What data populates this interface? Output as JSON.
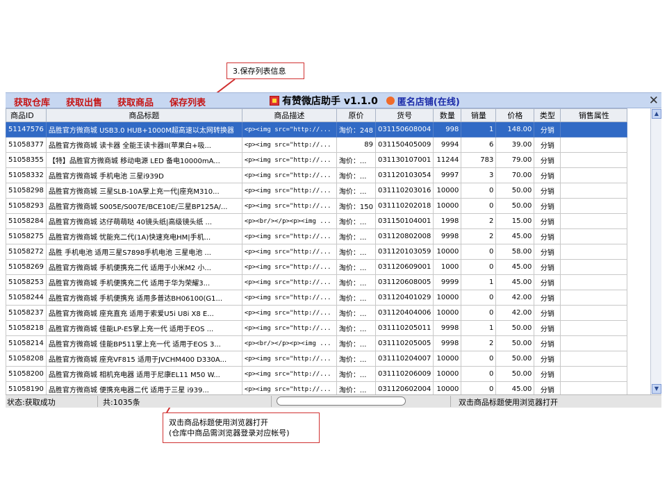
{
  "callouts": {
    "top": "3.保存列表信息",
    "bottom_line1": "双击商品标题使用浏览器打开",
    "bottom_line2": "(仓库中商品需浏览器登录对应帐号)"
  },
  "toolbar": {
    "buttons": [
      "获取仓库",
      "获取出售",
      "获取商品",
      "保存列表"
    ],
    "app_title": "有赞微店助手 v1.1.0",
    "store_name": "匿名店铺(在线)"
  },
  "table": {
    "columns": [
      "商品ID",
      "商品标题",
      "商品描述",
      "原价",
      "货号",
      "数量",
      "销量",
      "价格",
      "类型",
      "销售属性"
    ],
    "selected_row": 0,
    "rows": [
      [
        "51147576",
        "品胜官方微商城 USB3.0 HUB+1000M超高速以太网转换器",
        "<p><img src=\"http://...",
        "淘价：248",
        "031150608004",
        "998",
        "1",
        "148.00",
        "分销",
        ""
      ],
      [
        "51058377",
        "品胜官方微商城 读卡器 全能王读卡器II(苹果白+吸...",
        "<p><img src=\"http://...",
        "89",
        "031150405009",
        "9994",
        "6",
        "39.00",
        "分销",
        ""
      ],
      [
        "51058355",
        "【特】品胜官方微商城  移动电源 LED 备电10000mA...",
        "<p><img src=\"http://...",
        "淘价：...",
        "031130107001",
        "11244",
        "783",
        "79.00",
        "分销",
        ""
      ],
      [
        "51058332",
        "品胜官方微商城  手机电池 三星i939D",
        "<p><img src=\"http://...",
        "淘价：...",
        "031120103054",
        "9997",
        "3",
        "70.00",
        "分销",
        ""
      ],
      [
        "51058298",
        "品胜官方微商城  三星SLB-10A掌上充一代|座充M310...",
        "<p><img src=\"http://...",
        "淘价：...",
        "031110203016",
        "10000",
        "0",
        "50.00",
        "分销",
        ""
      ],
      [
        "51058293",
        "品胜官方微商城  S005E/S007E/BCE10E/三星BP125A/...",
        "<p><img src=\"http://...",
        "淘价：150",
        "031110202018",
        "10000",
        "0",
        "50.00",
        "分销",
        ""
      ],
      [
        "51058284",
        "品胜官方微商城 达仔萌萌哒 40镜头纸|高级镜头纸 ...",
        "<p><br/></p><p><img ...",
        "淘价：...",
        "031150104001",
        "1998",
        "2",
        "15.00",
        "分销",
        ""
      ],
      [
        "51058275",
        "品胜官方微商城  忧能充二代(1A)快速充电HM|手机...",
        "<p><img src=\"http://...",
        "淘价：...",
        "031120802008",
        "9998",
        "2",
        "45.00",
        "分销",
        ""
      ],
      [
        "51058272",
        "品胜 手机电池 适用三星S7898手机电池 三星电池 ...",
        "<p><img src=\"http://...",
        "淘价：...",
        "031120103059",
        "10000",
        "0",
        "58.00",
        "分销",
        ""
      ],
      [
        "51058269",
        "品胜官方微商城  手机便携充二代 适用于小米M2 小...",
        "<p><img src=\"http://...",
        "淘价：...",
        "031120609001",
        "1000",
        "0",
        "45.00",
        "分销",
        ""
      ],
      [
        "51058253",
        "品胜官方微商城  手机便携充二代 适用于华为荣耀3...",
        "<p><img src=\"http://...",
        "淘价：...",
        "031120608005",
        "9999",
        "1",
        "45.00",
        "分销",
        ""
      ],
      [
        "51058244",
        "品胜官方微商城 手机便携充 适用多普达BH06100(G1...",
        "<p><img src=\"http://...",
        "淘价：...",
        "031120401029",
        "10000",
        "0",
        "42.00",
        "分销",
        ""
      ],
      [
        "51058237",
        "品胜官方微商城 座充直充 适用于索爱U5i U8i X8 E...",
        "<p><img src=\"http://...",
        "淘价：...",
        "031120404006",
        "10000",
        "0",
        "42.00",
        "分销",
        ""
      ],
      [
        "51058218",
        "品胜官方微商城  佳能LP-E5掌上充一代 适用于EOS ...",
        "<p><img src=\"http://...",
        "淘价：...",
        "031110205011",
        "9998",
        "1",
        "50.00",
        "分销",
        ""
      ],
      [
        "51058214",
        "品胜官方微商城 佳能BP511掌上充一代 适用于EOS 3...",
        "<p><br/></p><p><img ...",
        "淘价：...",
        "031110205005",
        "9998",
        "2",
        "50.00",
        "分销",
        ""
      ],
      [
        "51058208",
        "品胜官方微商城  座充VF815 适用于JVCHM400 D330A...",
        "<p><img src=\"http://...",
        "淘价：...",
        "031110204007",
        "10000",
        "0",
        "50.00",
        "分销",
        ""
      ],
      [
        "51058200",
        "品胜官方微商城 相机充电器 适用于尼康EL11 M50 W...",
        "<p><img src=\"http://...",
        "淘价：...",
        "031110206009",
        "10000",
        "0",
        "50.00",
        "分销",
        ""
      ],
      [
        "51058190",
        "品胜官方微商城 便携充电器二代 适用于三星 i939...",
        "<p><img src=\"http://...",
        "淘价：...",
        "031120602004",
        "10000",
        "0",
        "45.00",
        "分销",
        ""
      ]
    ]
  },
  "status": {
    "state": "状态:获取成功",
    "count": "共:1035条",
    "hint": "双击商品标题使用浏览器打开"
  },
  "colors": {
    "toolbar_bg": "#c7d7f1",
    "button_text": "#c51414",
    "selection": "#316ac5",
    "store_text": "#1a2aa8",
    "callout_border": "#d03030"
  }
}
